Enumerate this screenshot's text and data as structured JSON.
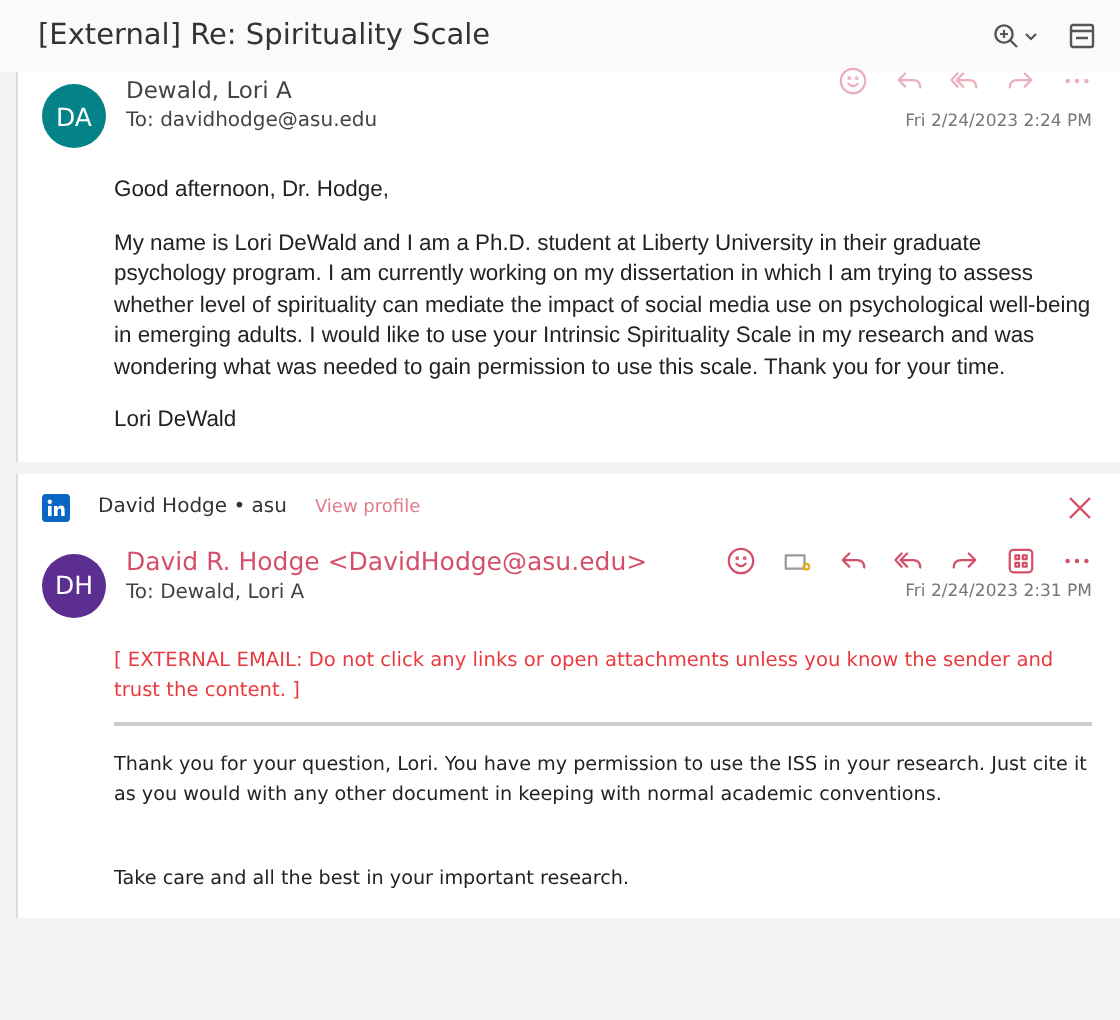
{
  "window": {
    "title": "[External] Re: Spirituality Scale"
  },
  "messages": [
    {
      "kind": "original",
      "avatar": {
        "initials": "DA",
        "color": "#038387"
      },
      "sender": "Dewald, Lori A",
      "sender_highlight": false,
      "to": "To:  davidhodge@asu.edu",
      "date": "Fri 2/24/2023 2:24 PM",
      "body": [
        "Good afternoon, Dr. Hodge,",
        "My name is Lori DeWald and I am a Ph.D. student at Liberty University in their graduate psychology program.  I am currently working on my dissertation in which I am trying to assess whether level of spirituality can mediate the impact of social media use on psychological well-being in emerging adults.  I would like to use your Intrinsic Spirituality Scale in my research and was wondering what was needed to gain permission to use this scale.  Thank you for your time.",
        "Lori DeWald"
      ]
    },
    {
      "kind": "reply",
      "avatar": {
        "initials": "DH",
        "color": "#5c2e91"
      },
      "sender": "David R. Hodge <DavidHodge@asu.edu>",
      "sender_highlight": true,
      "to": "To:  Dewald, Lori A",
      "date": "Fri 2/24/2023 2:31 PM",
      "banner": {
        "name": "David Hodge • asu",
        "link": "View profile"
      },
      "warning": "[ EXTERNAL EMAIL: Do not click any links or open attachments unless you know the sender and trust the content. ]",
      "body": [
        "Thank you for your question, Lori. You have my permission to use the ISS in your research. Just cite it as you would with any other document in keeping with normal academic conventions.",
        "Take care and all the best in your important research."
      ]
    }
  ]
}
